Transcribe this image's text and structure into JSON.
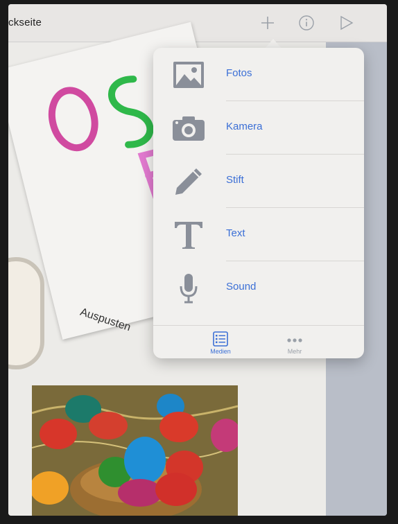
{
  "header": {
    "title": "ckseite"
  },
  "canvas": {
    "drawing_caption": "Auspusten"
  },
  "popover": {
    "items": [
      {
        "label": "Fotos",
        "icon": "photo-icon"
      },
      {
        "label": "Kamera",
        "icon": "camera-icon"
      },
      {
        "label": "Stift",
        "icon": "pencil-icon"
      },
      {
        "label": "Text",
        "icon": "text-icon"
      },
      {
        "label": "Sound",
        "icon": "microphone-icon"
      }
    ],
    "tabs": [
      {
        "label": "Medien",
        "icon": "list-icon",
        "selected": true
      },
      {
        "label": "Mehr",
        "icon": "more-dots-icon",
        "selected": false
      }
    ]
  },
  "colors": {
    "accent": "#3b6fd6",
    "icon_gray": "#8a8f99"
  }
}
